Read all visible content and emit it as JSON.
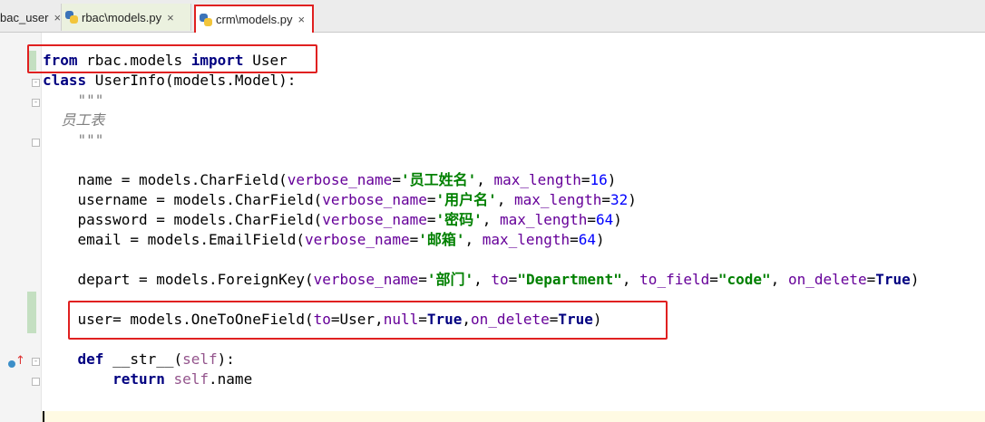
{
  "tabs": [
    {
      "label": "bac_user",
      "close": "×"
    },
    {
      "label": "rbac\\models.py",
      "close": "×"
    },
    {
      "label": "crm\\models.py",
      "close": "×"
    }
  ],
  "code": {
    "l1": {
      "kw1": "from",
      "t1": " rbac.models ",
      "kw2": "import",
      "t2": " User"
    },
    "l2": {
      "kw1": "class",
      "t1": " UserInfo(models.Model):"
    },
    "l3": "    \"\"\"",
    "l4": "    员工表",
    "l5": "    \"\"\"",
    "l6": {
      "a": "    name = models.CharField(",
      "p1": "verbose_name",
      "e1": "=",
      "s1": "'员工姓名'",
      "c1": ", ",
      "p2": "max_length",
      "e2": "=",
      "n1": "16",
      "z": ")"
    },
    "l7": {
      "a": "    username = models.CharField(",
      "p1": "verbose_name",
      "e1": "=",
      "s1": "'用户名'",
      "c1": ", ",
      "p2": "max_length",
      "e2": "=",
      "n1": "32",
      "z": ")"
    },
    "l8": {
      "a": "    password = models.CharField(",
      "p1": "verbose_name",
      "e1": "=",
      "s1": "'密码'",
      "c1": ", ",
      "p2": "max_length",
      "e2": "=",
      "n1": "64",
      "z": ")"
    },
    "l9": {
      "a": "    email = models.EmailField(",
      "p1": "verbose_name",
      "e1": "=",
      "s1": "'邮箱'",
      "c1": ", ",
      "p2": "max_length",
      "e2": "=",
      "n1": "64",
      "z": ")"
    },
    "l10": {
      "a": "    depart = models.ForeignKey(",
      "p1": "verbose_name",
      "e1": "=",
      "s1": "'部门'",
      "c1": ", ",
      "p2": "to",
      "e2": "=",
      "s2": "\"Department\"",
      "c2": ", ",
      "p3": "to_field",
      "e3": "=",
      "s3": "\"code\"",
      "c3": ", ",
      "p4": "on_delete",
      "e4": "=",
      "k1": "True",
      "z": ")"
    },
    "l11": {
      "a": "    user= models.OneToOneField(",
      "p1": "to",
      "e1": "=User,",
      "p2": "null",
      "e2": "=",
      "k1": "True",
      "c1": ",",
      "p3": "on_delete",
      "e3": "=",
      "k2": "True",
      "z": ")"
    },
    "l12": {
      "a": "    ",
      "kw": "def",
      "fn": " __str__(",
      "self": "self",
      "z": "):"
    },
    "l13": {
      "a": "        ",
      "kw": "return",
      "sp": " ",
      "self": "self",
      "z": ".name"
    }
  },
  "colors": {
    "highlight_box": "#e02020",
    "keyword": "#000080",
    "string": "#008000",
    "param": "#660099",
    "number": "#0000ff"
  }
}
